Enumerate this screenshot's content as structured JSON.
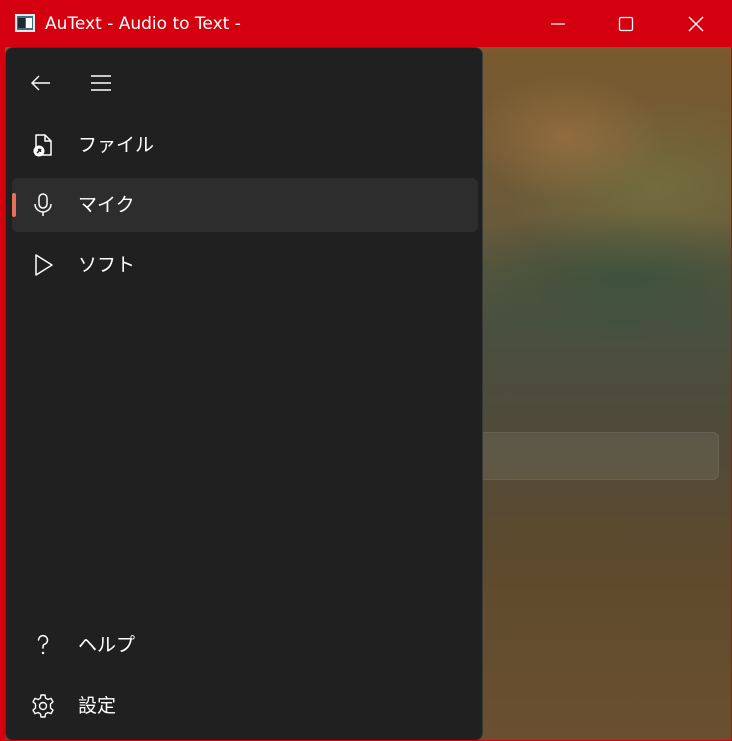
{
  "window": {
    "title": "AuText - Audio to Text -",
    "accent_color": "#d4000f"
  },
  "titlebar": {
    "app_icon": "app-icon",
    "minimize_icon": "minimize-icon",
    "maximize_icon": "maximize-icon",
    "close_icon": "close-icon"
  },
  "nav": {
    "back_icon": "back-arrow-icon",
    "menu_icon": "hamburger-menu-icon",
    "selection_indicator_color": "#e8715c",
    "items": [
      {
        "label": "ファイル",
        "icon": "audio-file-icon",
        "selected": false
      },
      {
        "label": "マイク",
        "icon": "microphone-icon",
        "selected": true
      },
      {
        "label": "ソフト",
        "icon": "play-icon",
        "selected": false
      }
    ],
    "footer_items": [
      {
        "label": "ヘルプ",
        "icon": "help-icon"
      },
      {
        "label": "設定",
        "icon": "gear-icon"
      }
    ]
  }
}
